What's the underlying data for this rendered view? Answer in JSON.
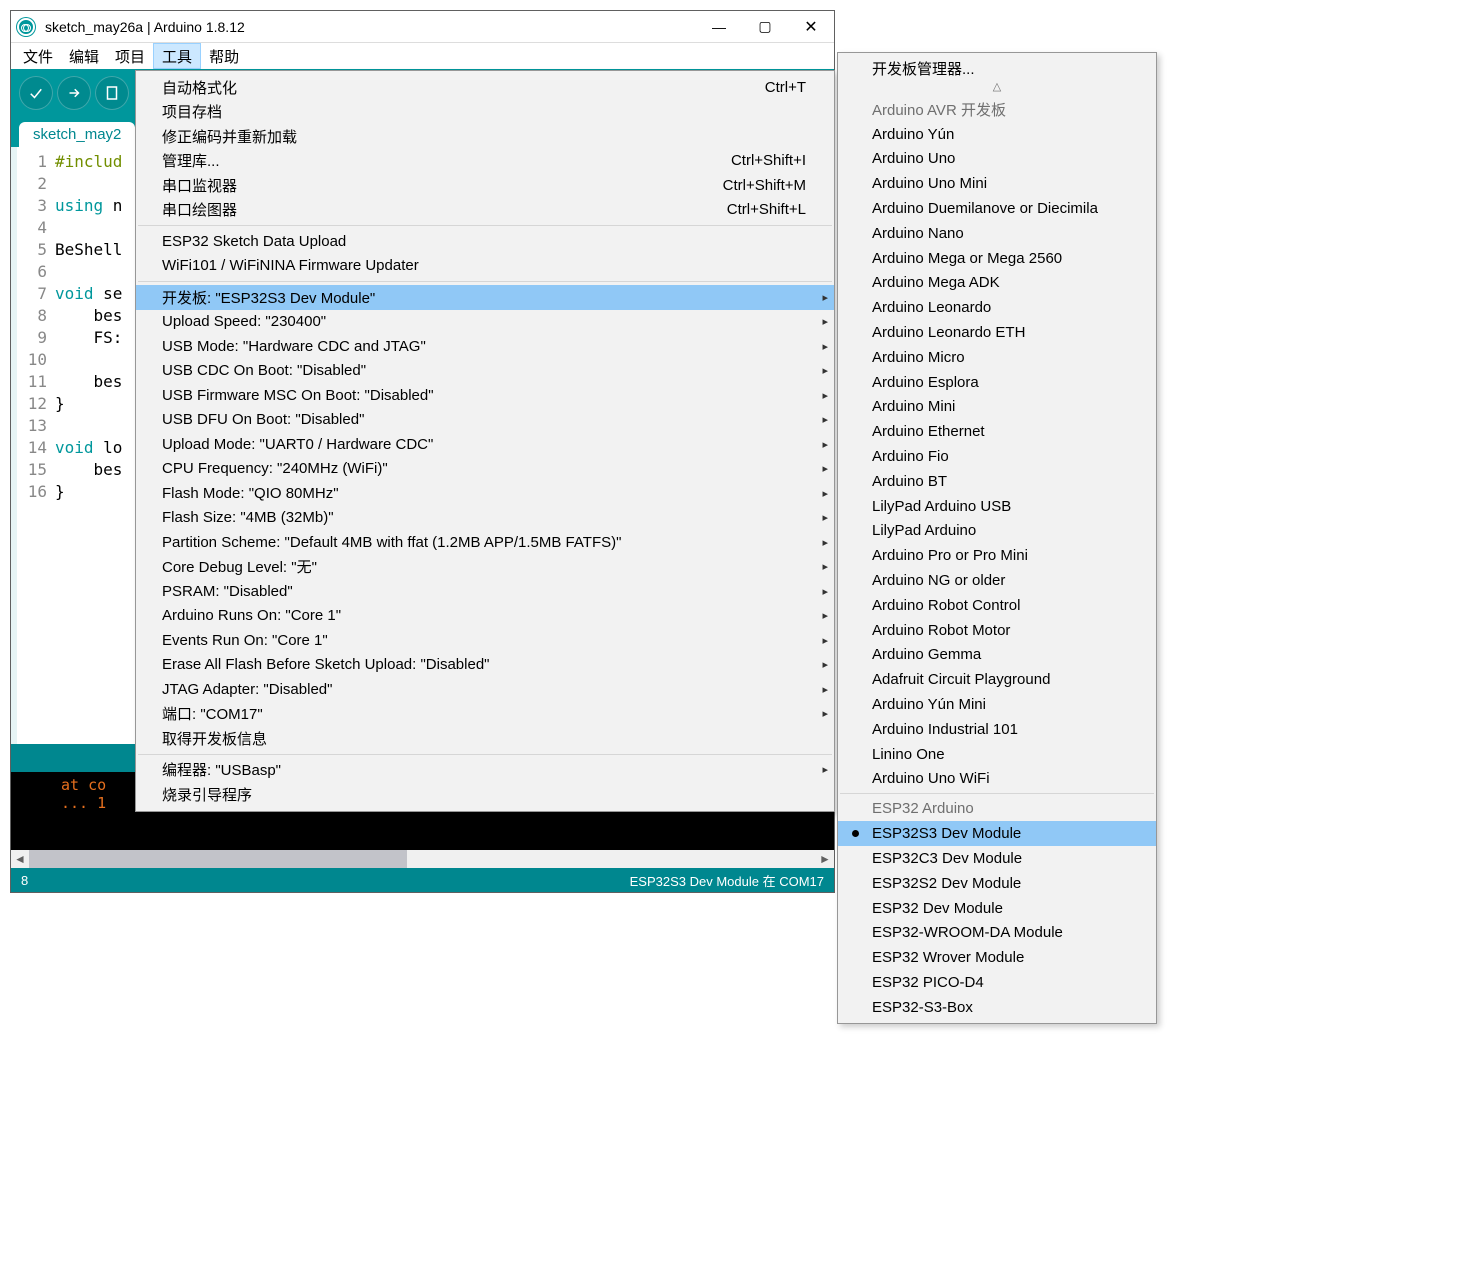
{
  "window": {
    "title": "sketch_may26a | Arduino 1.8.12"
  },
  "menubar": [
    "文件",
    "编辑",
    "项目",
    "工具",
    "帮助"
  ],
  "menubar_active_index": 3,
  "tab": {
    "label": "sketch_may2"
  },
  "code_lines": [
    "#includ",
    "",
    "using n",
    "",
    "BeShell",
    "",
    "void se",
    "    bes",
    "    FS:",
    "",
    "    bes",
    "}",
    "",
    "void lo",
    "    bes",
    "}"
  ],
  "console_lines": [
    "at co",
    "... 1"
  ],
  "footer": {
    "left": "8",
    "right": "ESP32S3 Dev Module 在 COM17"
  },
  "tools_menu": [
    {
      "label": "自动格式化",
      "shortcut": "Ctrl+T"
    },
    {
      "label": "项目存档"
    },
    {
      "label": "修正编码并重新加载"
    },
    {
      "label": "管理库...",
      "shortcut": "Ctrl+Shift+I"
    },
    {
      "label": "串口监视器",
      "shortcut": "Ctrl+Shift+M"
    },
    {
      "label": "串口绘图器",
      "shortcut": "Ctrl+Shift+L"
    },
    {
      "sep": true
    },
    {
      "label": "ESP32 Sketch Data Upload"
    },
    {
      "label": "WiFi101 / WiFiNINA Firmware Updater"
    },
    {
      "sep": true
    },
    {
      "label": "开发板: \"ESP32S3 Dev Module\"",
      "submenu": true,
      "highlight": true
    },
    {
      "label": "Upload Speed: \"230400\"",
      "submenu": true
    },
    {
      "label": "USB Mode: \"Hardware CDC and JTAG\"",
      "submenu": true
    },
    {
      "label": "USB CDC On Boot: \"Disabled\"",
      "submenu": true
    },
    {
      "label": "USB Firmware MSC On Boot: \"Disabled\"",
      "submenu": true
    },
    {
      "label": "USB DFU On Boot: \"Disabled\"",
      "submenu": true
    },
    {
      "label": "Upload Mode: \"UART0 / Hardware CDC\"",
      "submenu": true
    },
    {
      "label": "CPU Frequency: \"240MHz (WiFi)\"",
      "submenu": true
    },
    {
      "label": "Flash Mode: \"QIO 80MHz\"",
      "submenu": true
    },
    {
      "label": "Flash Size: \"4MB (32Mb)\"",
      "submenu": true
    },
    {
      "label": "Partition Scheme: \"Default 4MB with ffat (1.2MB APP/1.5MB FATFS)\"",
      "submenu": true
    },
    {
      "label": "Core Debug Level: \"无\"",
      "submenu": true
    },
    {
      "label": "PSRAM: \"Disabled\"",
      "submenu": true
    },
    {
      "label": "Arduino Runs On: \"Core 1\"",
      "submenu": true
    },
    {
      "label": "Events Run On: \"Core 1\"",
      "submenu": true
    },
    {
      "label": "Erase All Flash Before Sketch Upload: \"Disabled\"",
      "submenu": true
    },
    {
      "label": "JTAG Adapter: \"Disabled\"",
      "submenu": true
    },
    {
      "label": "端口: \"COM17\"",
      "submenu": true
    },
    {
      "label": "取得开发板信息"
    },
    {
      "sep": true
    },
    {
      "label": "编程器: \"USBasp\"",
      "submenu": true
    },
    {
      "label": "烧录引导程序"
    }
  ],
  "boards_top_item": "开发板管理器...",
  "board_groups": [
    {
      "header": "Arduino AVR 开发板",
      "items": [
        "Arduino Yún",
        "Arduino Uno",
        "Arduino Uno Mini",
        "Arduino Duemilanove or Diecimila",
        "Arduino Nano",
        "Arduino Mega or Mega 2560",
        "Arduino Mega ADK",
        "Arduino Leonardo",
        "Arduino Leonardo ETH",
        "Arduino Micro",
        "Arduino Esplora",
        "Arduino Mini",
        "Arduino Ethernet",
        "Arduino Fio",
        "Arduino BT",
        "LilyPad Arduino USB",
        "LilyPad Arduino",
        "Arduino Pro or Pro Mini",
        "Arduino NG or older",
        "Arduino Robot Control",
        "Arduino Robot Motor",
        "Arduino Gemma",
        "Adafruit Circuit Playground",
        "Arduino Yún Mini",
        "Arduino Industrial 101",
        "Linino One",
        "Arduino Uno WiFi"
      ]
    },
    {
      "header": "ESP32 Arduino",
      "items": [
        "ESP32S3 Dev Module",
        "ESP32C3 Dev Module",
        "ESP32S2 Dev Module",
        "ESP32 Dev Module",
        "ESP32-WROOM-DA Module",
        "ESP32 Wrover Module",
        "ESP32 PICO-D4",
        "ESP32-S3-Box"
      ],
      "selected": "ESP32S3 Dev Module"
    }
  ]
}
